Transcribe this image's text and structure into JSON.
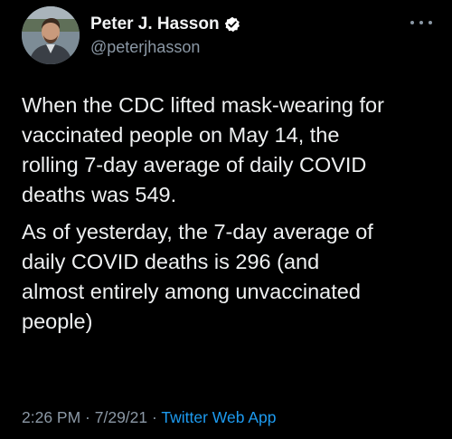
{
  "author": {
    "display_name": "Peter J. Hasson",
    "handle": "@peterjhasson",
    "verified": true,
    "avatar_icon": "profile-photo"
  },
  "menu": {
    "icon": "more-options-icon"
  },
  "tweet": {
    "paragraphs": [
      "When the CDC lifted mask-wearing for\nvaccinated people on May 14, the\nrolling 7-day average of daily COVID\ndeaths was 549.",
      "As of yesterday, the 7-day average of\ndaily COVID deaths is 296 (and\nalmost entirely among unvaccinated\npeople)"
    ]
  },
  "meta": {
    "time": "2:26 PM",
    "separator": " · ",
    "date": "7/29/21",
    "source": "Twitter Web App"
  },
  "colors": {
    "background": "#000000",
    "text": "#e7e9ea",
    "secondary": "#8b98a5",
    "accent": "#1d9bf0"
  }
}
